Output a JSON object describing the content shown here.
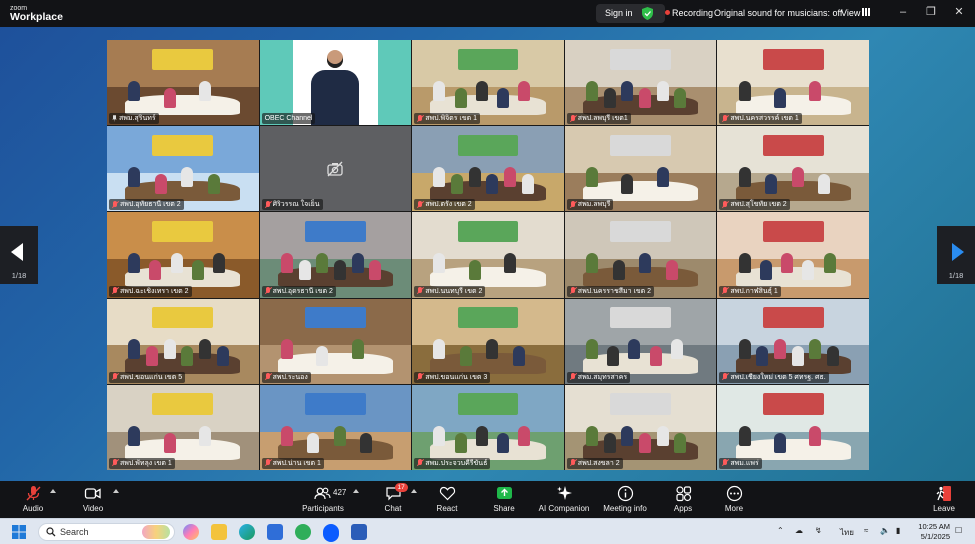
{
  "app": {
    "logo_line1": "zoom",
    "logo_line2": "Workplace"
  },
  "titlebar": {
    "signin": "Sign in",
    "recording": "Recording",
    "original_sound": "Original sound for musicians: off",
    "view": "View"
  },
  "pager": {
    "left": "1/18",
    "right": "1/18"
  },
  "tiles": [
    {
      "name": "สพม.สุรินทร์",
      "pin": true
    },
    {
      "name": "OBEC Channel",
      "active": true
    },
    {
      "name": "สพป.พิจิตร เขต 1"
    },
    {
      "name": "สพป.ลพบุรี เขต1"
    },
    {
      "name": "สพป.นครสวรรค์ เขต 1"
    },
    {
      "name": "สพป.อุทัยธานี เขต 2"
    },
    {
      "name": "ศิริวรรณ ใจเย็น",
      "camera_off": true
    },
    {
      "name": "สพป.ตรัง เขต 2"
    },
    {
      "name": "สพม.ลพบุรี"
    },
    {
      "name": "สพป.สุโขทัย เขต 2"
    },
    {
      "name": "สพป.ฉะเชิงเทรา เขต 2"
    },
    {
      "name": "สพป.อุดรธานี เขต 2"
    },
    {
      "name": "สพป.นนทบุรี เขต 2"
    },
    {
      "name": "สพป.นครราชสีมา เขต 2"
    },
    {
      "name": "สพป.กาฬสินธุ์ 1"
    },
    {
      "name": "สพป.ขอนแก่น เขต 5"
    },
    {
      "name": "สพป.ระนอง"
    },
    {
      "name": "สพป.ขอนแก่น เขต 3"
    },
    {
      "name": "สพม.สมุทรสาคร"
    },
    {
      "name": "สพป.เชียงใหม่ เขต 5 ศทรฐ. ศธ."
    },
    {
      "name": "สพป.พัทลุง เขต 1"
    },
    {
      "name": "สพป.น่าน เขต 1"
    },
    {
      "name": "สพม.ประจวบคีรีขันธ์"
    },
    {
      "name": "สพป.สงขลา 2"
    },
    {
      "name": "สพม.แพร่"
    }
  ],
  "toolbar": {
    "audio": "Audio",
    "video": "Video",
    "participants": "Participants",
    "participants_count": "427",
    "chat": "Chat",
    "chat_badge": "17",
    "react": "React",
    "share": "Share",
    "ai_companion": "AI Companion",
    "meeting_info": "Meeting info",
    "apps": "Apps",
    "more": "More",
    "leave": "Leave"
  },
  "taskbar": {
    "search_placeholder": "Search",
    "language": "ไทย",
    "time": "10:25 AM",
    "date": "5/1/2025"
  },
  "colors": {
    "active_outline": "#5bd37a",
    "recording": "#e8413a",
    "share": "#1fb84a",
    "leave": "#e8413a"
  }
}
